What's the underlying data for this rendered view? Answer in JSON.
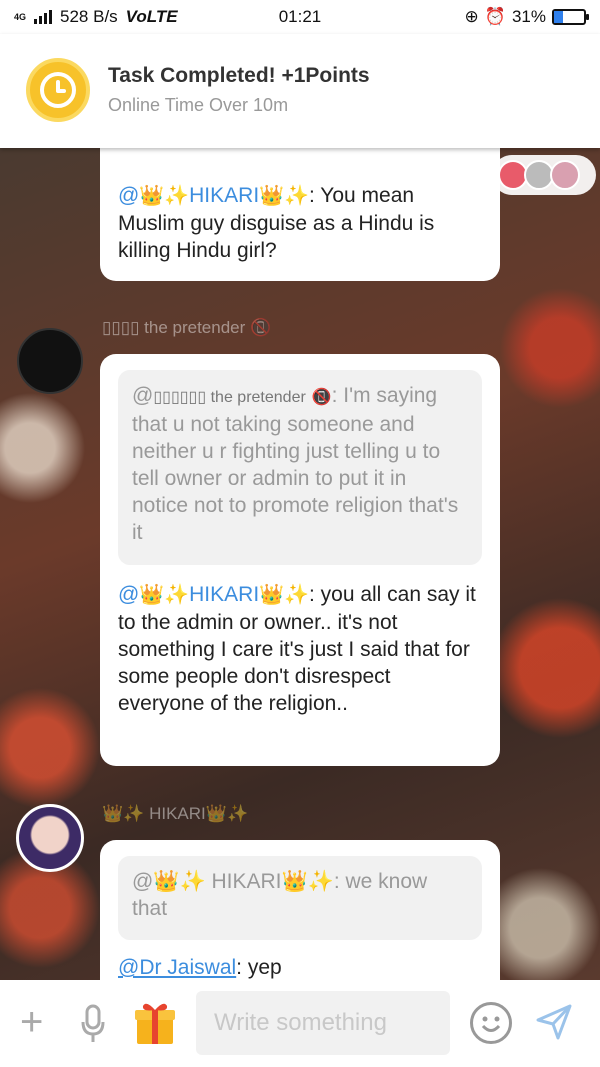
{
  "status_bar": {
    "network": "4G",
    "speed": "528 B/s",
    "volte": "VoLTE",
    "time": "01:21",
    "battery": "31%",
    "battery_level": 0.31
  },
  "notification": {
    "title": "Task Completed! +1Points",
    "subtitle": "Online Time Over 10m"
  },
  "messages": [
    {
      "quote_author": "@",
      "author_display": "HIKARI",
      "text_before": ": You mean Muslim guy disguise as a Hindu is killing Hindu girl?"
    },
    {
      "sender_name": "the pretender",
      "quote": {
        "mention": "@",
        "name": "the pretender",
        "text": ": I'm saying that u not taking someone and neither u r fighting just telling u to tell owner or admin to put it in notice not to promote religion that's it"
      },
      "mention": "@",
      "mention_name": "HIKARI",
      "text": ": you all can say it to the admin or owner.. it's not something I care it's just I said that for some people don't disrespect everyone of the religion.."
    },
    {
      "sender_name": "HIKARI",
      "quote": {
        "mention": "@",
        "name": "HIKARI",
        "text": ": we know that"
      },
      "partial_mention": "@Dr Jaiswal",
      "partial_text": ": yep"
    }
  ],
  "input": {
    "placeholder": "Write something"
  },
  "colors": {
    "mention": "#3c8dde",
    "notif_icon": "#f7c22a",
    "battery_fill": "#2f80ed"
  }
}
